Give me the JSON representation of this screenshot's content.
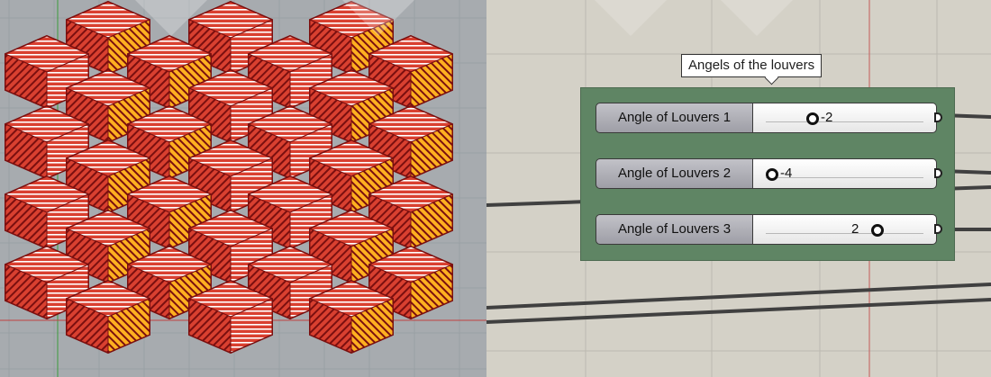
{
  "viewport": {
    "background": "#a7abaf",
    "panel_color": "#d94030",
    "panel_edge_color": "#7a0f0f",
    "stripe_color": "#ffffff",
    "accent_color": "#ffb020"
  },
  "canvas": {
    "background": "#d4d1c7",
    "group": {
      "label": "Angels of the louvers",
      "color": "#5f8564"
    },
    "sliders": [
      {
        "name": "Angle of Louvers 1",
        "value": "-2",
        "fraction": 0.3
      },
      {
        "name": "Angle of Louvers 2",
        "value": "-4",
        "fraction": 0.0
      },
      {
        "name": "Angle of Louvers 3",
        "value": "2",
        "fraction": 0.78
      }
    ]
  }
}
